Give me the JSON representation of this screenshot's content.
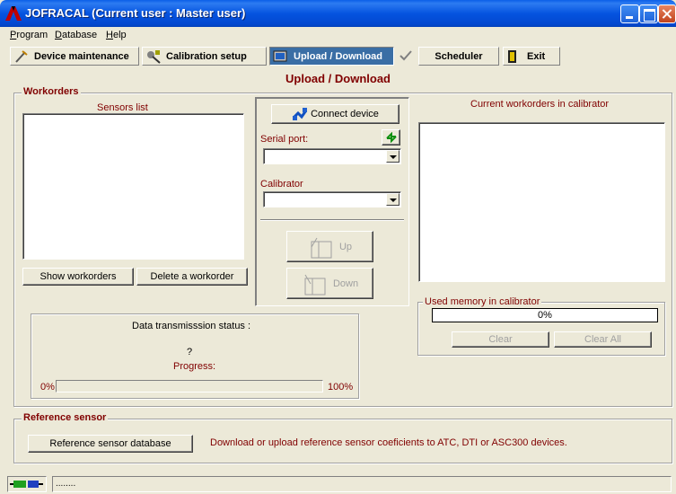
{
  "window": {
    "title": "JOFRACAL (Current user : Master user)"
  },
  "menu": {
    "items": [
      "Program",
      "Database",
      "Help"
    ]
  },
  "toolbar": {
    "device_maintenance": "Device maintenance",
    "calibration_setup": "Calibration setup",
    "upload_download": "Upload / Download",
    "scheduler": "Scheduler",
    "exit": "Exit"
  },
  "page_title": "Upload / Download",
  "workorders": {
    "group_title": "Workorders",
    "sensors_list_label": "Sensors list",
    "show_workorders": "Show workorders",
    "delete_workorder": "Delete a workorder",
    "connect_device": "Connect device",
    "serial_port_label": "Serial port:",
    "serial_port_value": "",
    "calibrator_label": "Calibrator",
    "calibrator_value": "",
    "up": "Up",
    "down": "Down",
    "current_workorders_label": "Current workorders in calibrator",
    "used_memory_title": "Used memory in calibrator",
    "used_memory_value": "0%",
    "clear": "Clear",
    "clear_all": "Clear All",
    "transmission_status_label": "Data  transmisssion status :",
    "transmission_status_value": "?",
    "progress_label": "Progress:",
    "progress_min": "0%",
    "progress_max": "100%",
    "progress_fraction": 0
  },
  "reference_sensor": {
    "group_title": "Reference sensor",
    "database_button": "Reference sensor database",
    "description": "Download or upload reference sensor coeficients to ATC, DTI or ASC300 devices."
  },
  "statusbar": {
    "text": "........"
  },
  "icons": {
    "app": "jofracal-logo-icon",
    "device_maintenance": "caliper-icon",
    "calibration_setup": "wrench-gear-icon",
    "upload_download": "upload-download-icon",
    "scheduler": "check-mark-icon",
    "exit": "exit-door-icon",
    "connect_device": "connect-icon",
    "refresh_ports": "refresh-arrows-icon",
    "status": "plug-icon"
  }
}
